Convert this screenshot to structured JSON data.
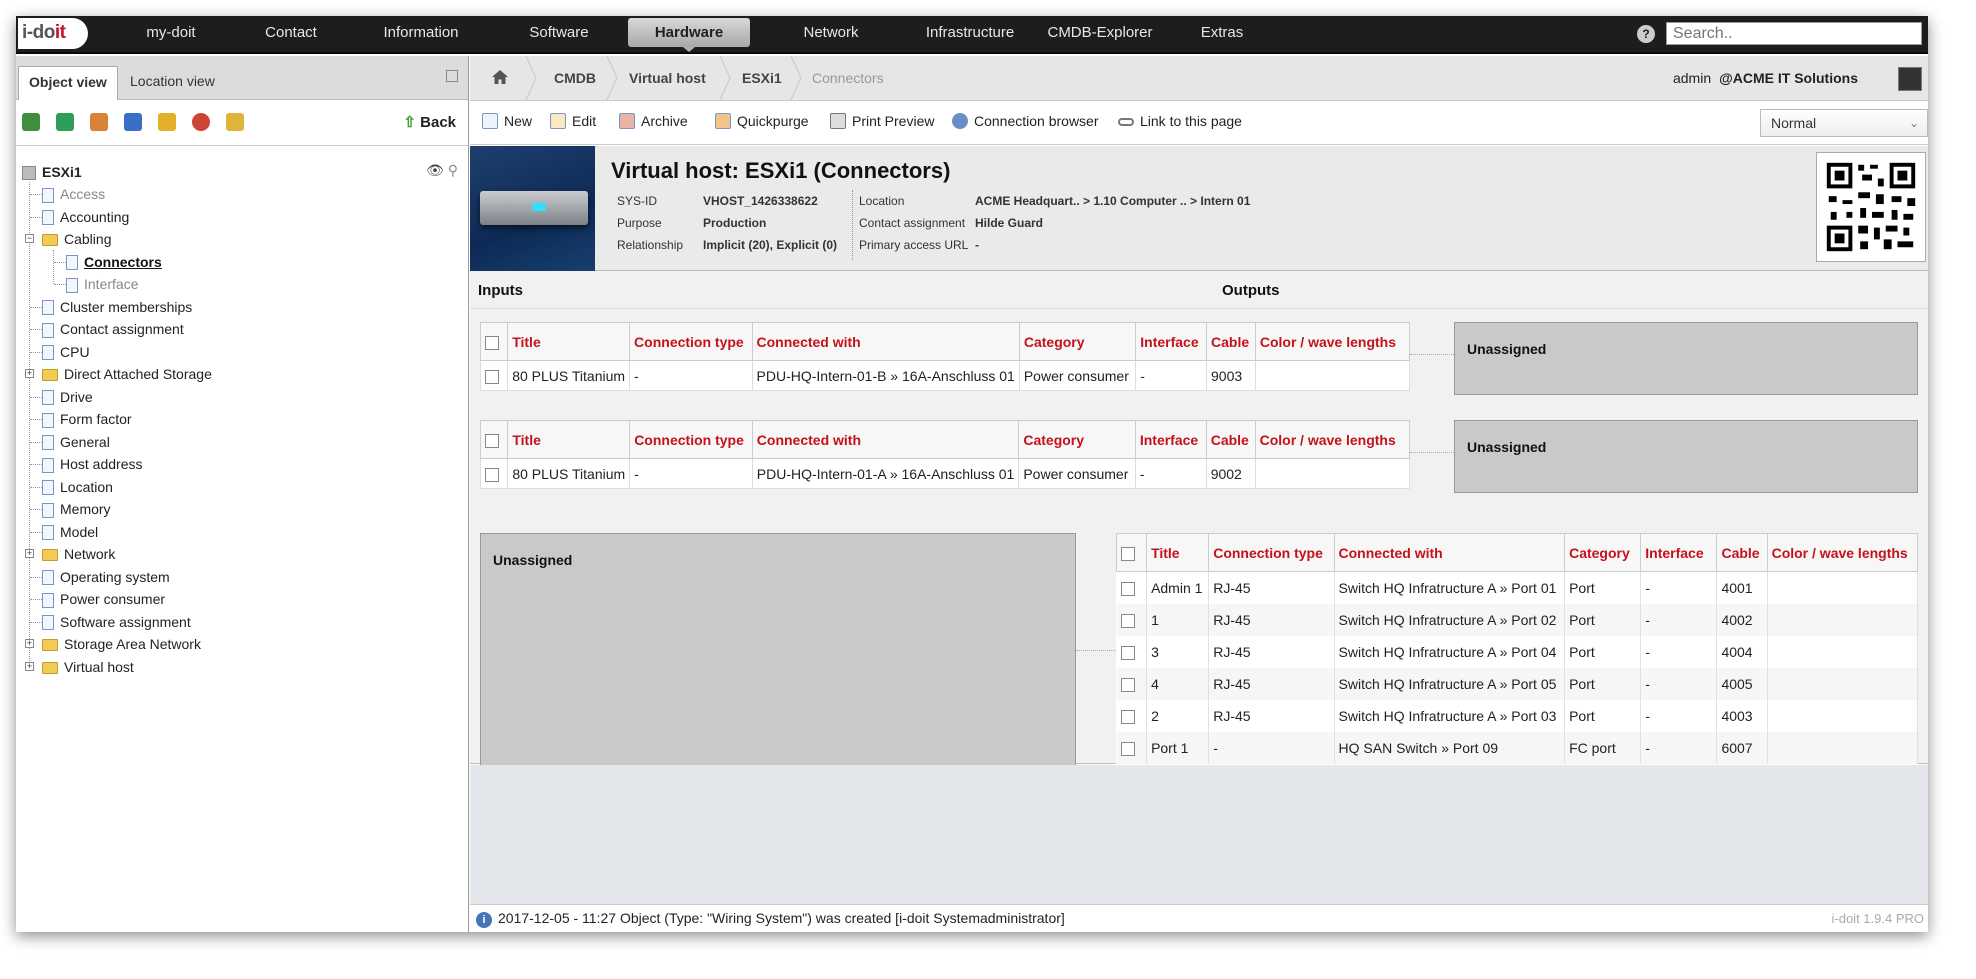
{
  "nav": {
    "logo_main": "i-do",
    "logo_accent": "it",
    "items": [
      "my-doit",
      "Contact",
      "Information",
      "Software",
      "Hardware",
      "Network",
      "Infrastructure",
      "CMDB-Explorer",
      "Extras"
    ],
    "active": "Hardware",
    "search_placeholder": "Search.."
  },
  "left_panel": {
    "tabs": [
      "Object view",
      "Location view"
    ],
    "back_label": "Back",
    "root": "ESXi1",
    "tree": [
      {
        "label": "Access",
        "type": "doc",
        "dim": true
      },
      {
        "label": "Accounting",
        "type": "doc"
      },
      {
        "label": "Cabling",
        "type": "folder",
        "expanded": true
      },
      {
        "label": "Connectors",
        "type": "doc",
        "child": true,
        "selected": true
      },
      {
        "label": "Interface",
        "type": "doc",
        "child": true,
        "dim": true
      },
      {
        "label": "Cluster memberships",
        "type": "doc"
      },
      {
        "label": "Contact assignment",
        "type": "doc"
      },
      {
        "label": "CPU",
        "type": "doc"
      },
      {
        "label": "Direct Attached Storage",
        "type": "folder"
      },
      {
        "label": "Drive",
        "type": "doc"
      },
      {
        "label": "Form factor",
        "type": "doc"
      },
      {
        "label": "General",
        "type": "doc"
      },
      {
        "label": "Host address",
        "type": "doc"
      },
      {
        "label": "Location",
        "type": "doc"
      },
      {
        "label": "Memory",
        "type": "doc"
      },
      {
        "label": "Model",
        "type": "doc"
      },
      {
        "label": "Network",
        "type": "folder"
      },
      {
        "label": "Operating system",
        "type": "doc"
      },
      {
        "label": "Power consumer",
        "type": "doc"
      },
      {
        "label": "Software assignment",
        "type": "doc"
      },
      {
        "label": "Storage Area Network",
        "type": "folder"
      },
      {
        "label": "Virtual host",
        "type": "folder"
      }
    ]
  },
  "breadcrumb": [
    "CMDB",
    "Virtual host",
    "ESXi1",
    "Connectors"
  ],
  "user": {
    "name": "admin",
    "org": "@ACME IT Solutions"
  },
  "actions": [
    "New",
    "Edit",
    "Archive",
    "Quickpurge",
    "Print Preview",
    "Connection browser",
    "Link to this page"
  ],
  "mode_select": "Normal",
  "object": {
    "title": "Virtual host: ESXi1 (Connectors)",
    "left_fields": [
      {
        "label": "SYS-ID",
        "value": "VHOST_1426338622"
      },
      {
        "label": "Purpose",
        "value": "Production"
      },
      {
        "label": "Relationship",
        "value": "Implicit (20), Explicit (0)"
      }
    ],
    "right_fields": [
      {
        "label": "Location",
        "value": "ACME Headquart.. > 1.10 Computer .. > Intern 01"
      },
      {
        "label": "Contact assignment",
        "value": "Hilde Guard"
      },
      {
        "label": "Primary access URL",
        "value": "-"
      }
    ]
  },
  "io": {
    "inputs_label": "Inputs",
    "outputs_label": "Outputs",
    "unassigned_label": "Unassigned"
  },
  "input_columns": [
    "Title",
    "Connection type",
    "Connected with",
    "Category",
    "Interface",
    "Cable",
    "Color / wave lengths"
  ],
  "input_tables": [
    [
      {
        "title": "80 PLUS Titanium",
        "type": "-",
        "connected": "PDU-HQ-Intern-01-B » 16A-Anschluss 01",
        "category": "Power consumer",
        "interface": "-",
        "cable": "9003",
        "color": ""
      }
    ],
    [
      {
        "title": "80 PLUS Titanium",
        "type": "-",
        "connected": "PDU-HQ-Intern-01-A » 16A-Anschluss 01",
        "category": "Power consumer",
        "interface": "-",
        "cable": "9002",
        "color": ""
      }
    ]
  ],
  "output_rows": [
    {
      "title": "Admin 1",
      "type": "RJ-45",
      "connected": "Switch HQ Infratructure A » Port 01",
      "category": "Port",
      "interface": "-",
      "cable": "4001",
      "color": ""
    },
    {
      "title": "1",
      "type": "RJ-45",
      "connected": "Switch HQ Infratructure A » Port 02",
      "category": "Port",
      "interface": "-",
      "cable": "4002",
      "color": ""
    },
    {
      "title": "3",
      "type": "RJ-45",
      "connected": "Switch HQ Infratructure A » Port 04",
      "category": "Port",
      "interface": "-",
      "cable": "4004",
      "color": ""
    },
    {
      "title": "4",
      "type": "RJ-45",
      "connected": "Switch HQ Infratructure A » Port 05",
      "category": "Port",
      "interface": "-",
      "cable": "4005",
      "color": ""
    },
    {
      "title": "2",
      "type": "RJ-45",
      "connected": "Switch HQ Infratructure A » Port 03",
      "category": "Port",
      "interface": "-",
      "cable": "4003",
      "color": ""
    },
    {
      "title": "Port 1",
      "type": "-",
      "connected": "HQ SAN Switch » Port 09",
      "category": "FC port",
      "interface": "-",
      "cable": "6007",
      "color": ""
    }
  ],
  "status": {
    "message": "2017-12-05 - 11:27 Object (Type: \"Wiring System\") was created [i-doit Systemadministrator]",
    "version": "i-doit 1.9.4 PRO"
  }
}
